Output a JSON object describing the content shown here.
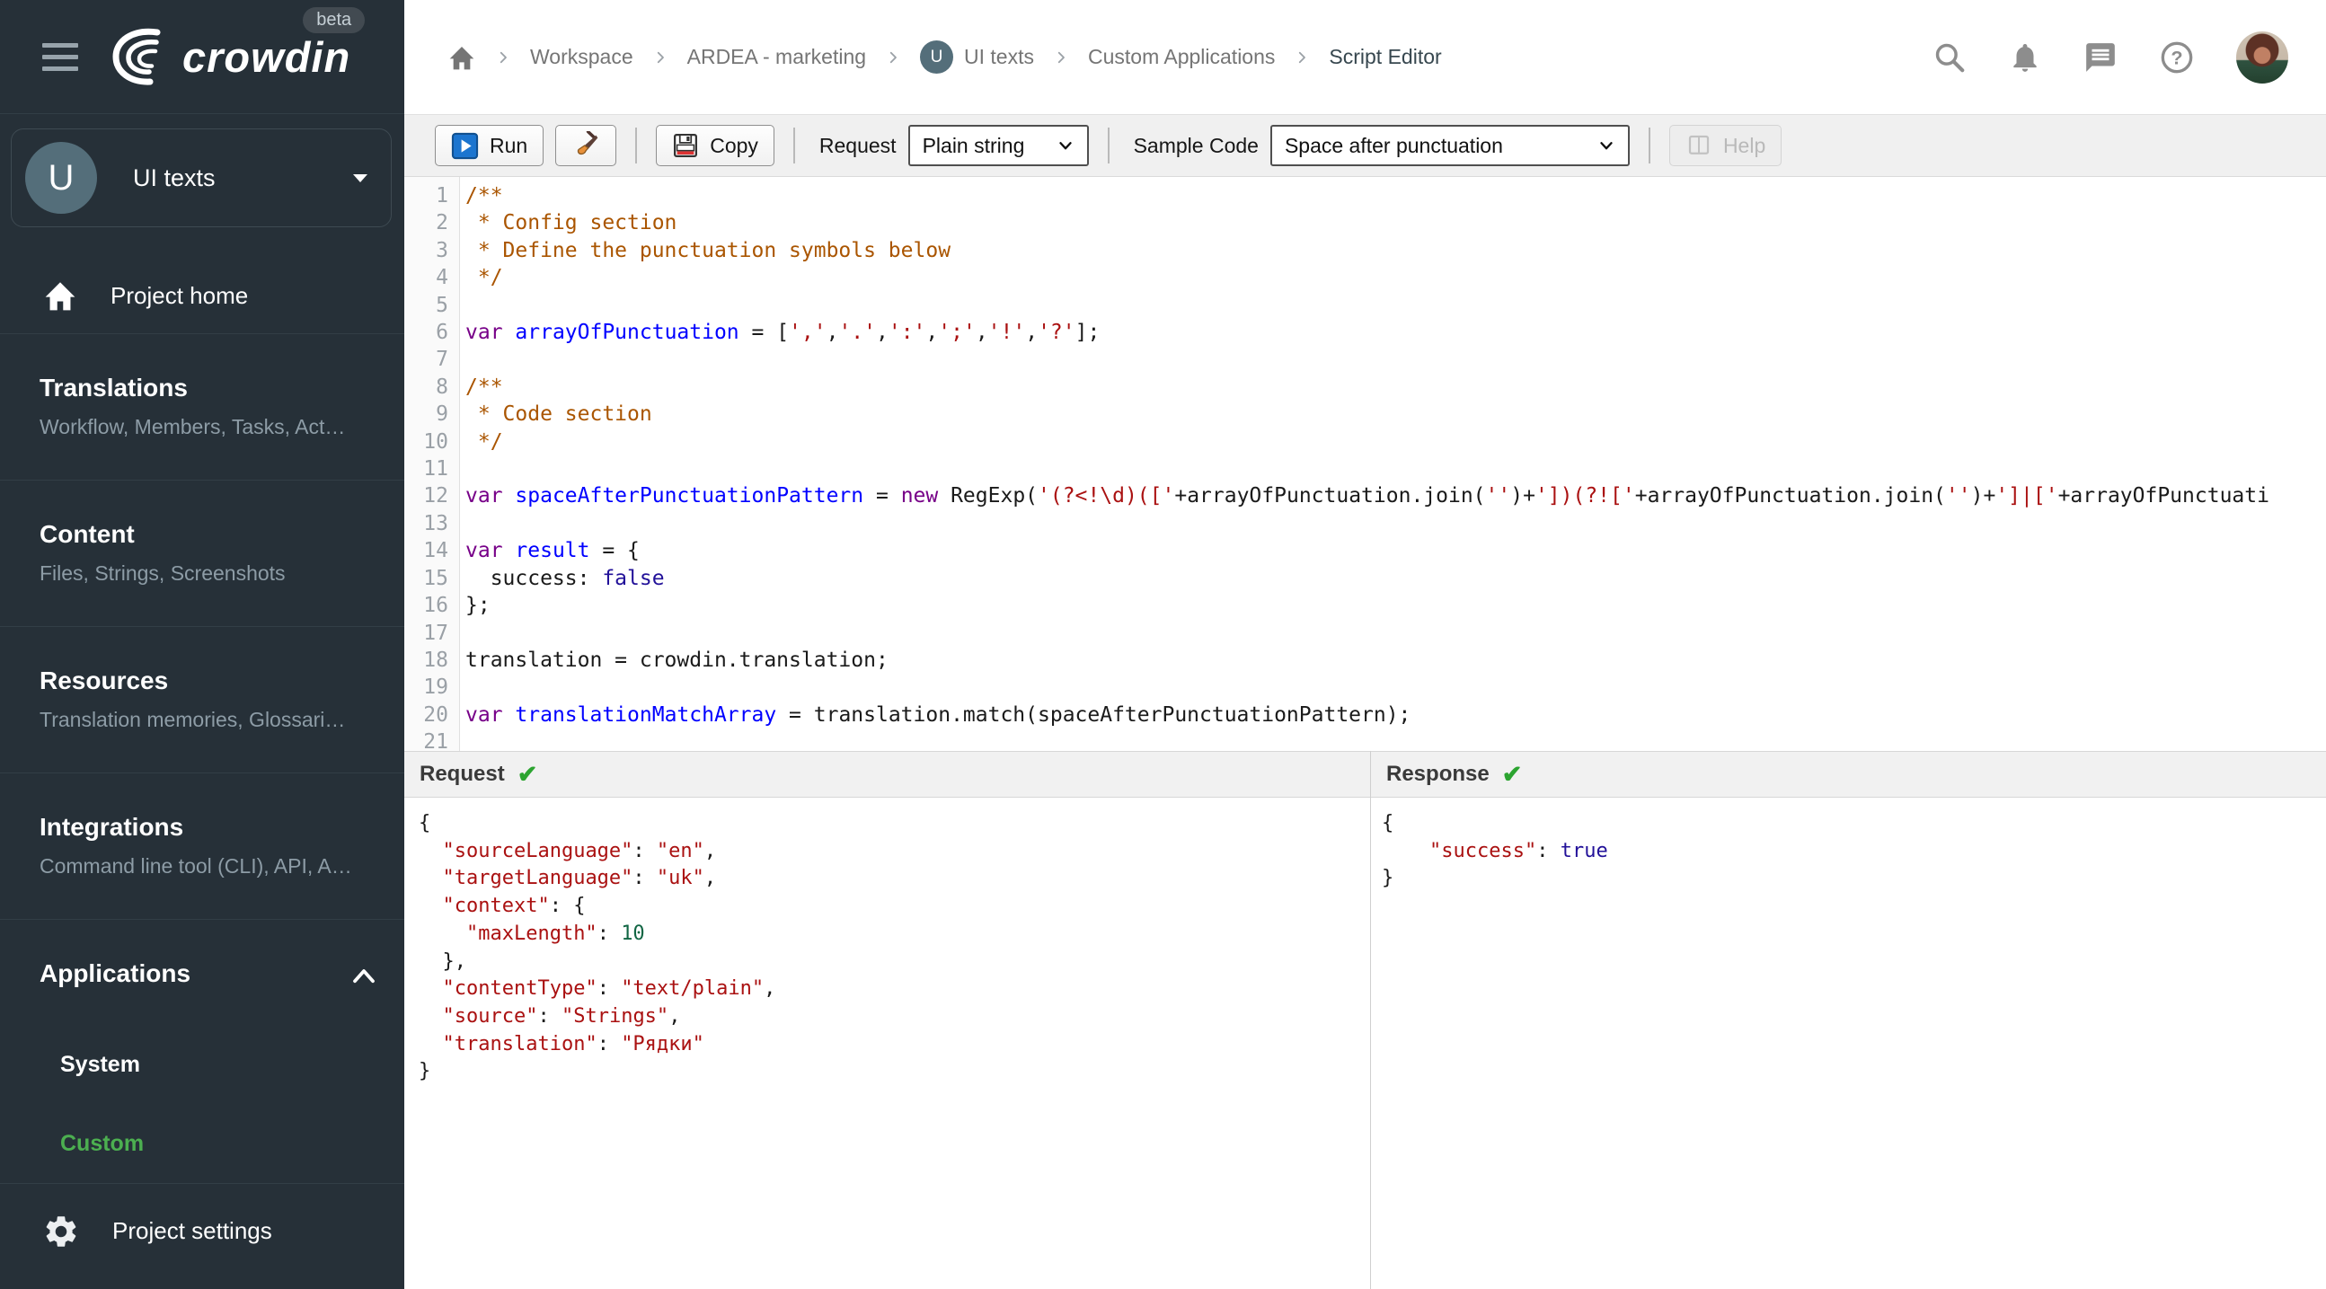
{
  "sidebar": {
    "logo_text": "crowdin",
    "beta_badge": "beta",
    "project_selector": {
      "initial": "U",
      "name": "UI texts"
    },
    "project_home_label": "Project home",
    "sections": [
      {
        "title": "Translations",
        "subtitle": "Workflow, Members, Tasks, Act…"
      },
      {
        "title": "Content",
        "subtitle": "Files, Strings, Screenshots"
      },
      {
        "title": "Resources",
        "subtitle": "Translation memories, Glossari…"
      },
      {
        "title": "Integrations",
        "subtitle": "Command line tool (CLI), API, A…"
      }
    ],
    "applications": {
      "title": "Applications",
      "items": [
        {
          "label": "System",
          "active": false
        },
        {
          "label": "Custom",
          "active": true
        }
      ]
    },
    "project_settings_label": "Project settings",
    "colors": {
      "background": "#263038",
      "active_item_green": "#4caf50"
    }
  },
  "breadcrumb": {
    "project_initial": "U",
    "items": [
      "Workspace",
      "ARDEA - marketing",
      "UI texts",
      "Custom Applications",
      "Script Editor"
    ]
  },
  "toolbar": {
    "run_label": "Run",
    "copy_label": "Copy",
    "request_label": "Request",
    "request_value": "Plain string",
    "sample_code_label": "Sample Code",
    "sample_code_value": "Space after punctuation",
    "help_label": "Help"
  },
  "editor": {
    "lines": [
      {
        "t": [
          [
            "comment",
            "/**"
          ]
        ]
      },
      {
        "t": [
          [
            "comment",
            " * Config section"
          ]
        ]
      },
      {
        "t": [
          [
            "comment",
            " * Define the punctuation symbols below"
          ]
        ]
      },
      {
        "t": [
          [
            "comment",
            " */"
          ]
        ]
      },
      {
        "t": []
      },
      {
        "t": [
          [
            "keyword",
            "var"
          ],
          [
            "plain",
            " "
          ],
          [
            "def",
            "arrayOfPunctuation"
          ],
          [
            "plain",
            " = ["
          ],
          [
            "string",
            "','"
          ],
          [
            "plain",
            ","
          ],
          [
            "string",
            "'.'"
          ],
          [
            "plain",
            ","
          ],
          [
            "string",
            "':'"
          ],
          [
            "plain",
            ","
          ],
          [
            "string",
            "';'"
          ],
          [
            "plain",
            ","
          ],
          [
            "string",
            "'!'"
          ],
          [
            "plain",
            ","
          ],
          [
            "string",
            "'?'"
          ],
          [
            "plain",
            "];"
          ]
        ]
      },
      {
        "t": []
      },
      {
        "t": [
          [
            "comment",
            "/**"
          ]
        ]
      },
      {
        "t": [
          [
            "comment",
            " * Code section"
          ]
        ]
      },
      {
        "t": [
          [
            "comment",
            " */"
          ]
        ]
      },
      {
        "t": []
      },
      {
        "t": [
          [
            "keyword",
            "var"
          ],
          [
            "plain",
            " "
          ],
          [
            "def",
            "spaceAfterPunctuationPattern"
          ],
          [
            "plain",
            " = "
          ],
          [
            "keyword",
            "new"
          ],
          [
            "plain",
            " RegExp("
          ],
          [
            "string",
            "'(?<!\\d)(['"
          ],
          [
            "plain",
            "+arrayOfPunctuation.join("
          ],
          [
            "string",
            "''"
          ],
          [
            "plain",
            ")+"
          ],
          [
            "string",
            "'])(?!['"
          ],
          [
            "plain",
            "+arrayOfPunctuation.join("
          ],
          [
            "string",
            "''"
          ],
          [
            "plain",
            ")+"
          ],
          [
            "string",
            "']|['"
          ],
          [
            "plain",
            "+arrayOfPunctuati"
          ]
        ]
      },
      {
        "t": []
      },
      {
        "t": [
          [
            "keyword",
            "var"
          ],
          [
            "plain",
            " "
          ],
          [
            "def",
            "result"
          ],
          [
            "plain",
            " = {"
          ]
        ]
      },
      {
        "t": [
          [
            "plain",
            "  success: "
          ],
          [
            "atom",
            "false"
          ]
        ]
      },
      {
        "t": [
          [
            "plain",
            "};"
          ]
        ]
      },
      {
        "t": []
      },
      {
        "t": [
          [
            "plain",
            "translation = crowdin.translation;"
          ]
        ]
      },
      {
        "t": []
      },
      {
        "t": [
          [
            "keyword",
            "var"
          ],
          [
            "plain",
            " "
          ],
          [
            "def",
            "translationMatchArray"
          ],
          [
            "plain",
            " = translation.match(spaceAfterPunctuationPattern);"
          ]
        ]
      },
      {
        "t": []
      }
    ]
  },
  "panels": {
    "check_glyph": "✔"
  },
  "request_panel": {
    "title": "Request",
    "lines": [
      {
        "t": [
          [
            "plain",
            "{"
          ]
        ]
      },
      {
        "t": [
          [
            "plain",
            "  "
          ],
          [
            "string",
            "\"sourceLanguage\""
          ],
          [
            "plain",
            ": "
          ],
          [
            "string",
            "\"en\""
          ],
          [
            "plain",
            ","
          ]
        ]
      },
      {
        "t": [
          [
            "plain",
            "  "
          ],
          [
            "string",
            "\"targetLanguage\""
          ],
          [
            "plain",
            ": "
          ],
          [
            "string",
            "\"uk\""
          ],
          [
            "plain",
            ","
          ]
        ]
      },
      {
        "t": [
          [
            "plain",
            "  "
          ],
          [
            "string",
            "\"context\""
          ],
          [
            "plain",
            ": {"
          ]
        ]
      },
      {
        "t": [
          [
            "plain",
            "    "
          ],
          [
            "string",
            "\"maxLength\""
          ],
          [
            "plain",
            ": "
          ],
          [
            "number",
            "10"
          ]
        ]
      },
      {
        "t": [
          [
            "plain",
            "  },"
          ]
        ]
      },
      {
        "t": [
          [
            "plain",
            "  "
          ],
          [
            "string",
            "\"contentType\""
          ],
          [
            "plain",
            ": "
          ],
          [
            "string",
            "\"text/plain\""
          ],
          [
            "plain",
            ","
          ]
        ]
      },
      {
        "t": [
          [
            "plain",
            "  "
          ],
          [
            "string",
            "\"source\""
          ],
          [
            "plain",
            ": "
          ],
          [
            "string",
            "\"Strings\""
          ],
          [
            "plain",
            ","
          ]
        ]
      },
      {
        "t": [
          [
            "plain",
            "  "
          ],
          [
            "string",
            "\"translation\""
          ],
          [
            "plain",
            ": "
          ],
          [
            "string",
            "\"Рядки\""
          ]
        ]
      },
      {
        "t": [
          [
            "plain",
            "}"
          ]
        ]
      }
    ]
  },
  "response_panel": {
    "title": "Response",
    "lines": [
      {
        "t": [
          [
            "plain",
            "{"
          ]
        ]
      },
      {
        "t": [
          [
            "plain",
            "    "
          ],
          [
            "string",
            "\"success\""
          ],
          [
            "plain",
            ": "
          ],
          [
            "atom",
            "true"
          ]
        ]
      },
      {
        "t": [
          [
            "plain",
            "}"
          ]
        ]
      }
    ]
  }
}
